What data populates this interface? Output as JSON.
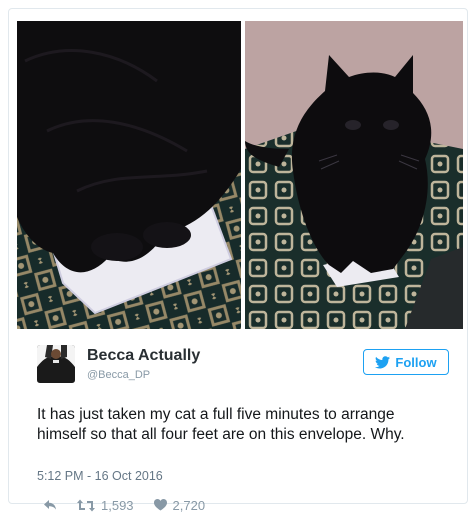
{
  "tweet": {
    "author_name": "Becca Actually",
    "author_handle": "@Becca_DP",
    "follow_label": "Follow",
    "text": "It has just taken my cat a full five minutes to arrange himself so that all four feet are on this envelope. Why.",
    "timestamp": "5:12 PM - 16 Oct 2016",
    "retweet_count": "1,593",
    "like_count": "2,720"
  },
  "icons": {
    "reply": "reply-icon",
    "retweet": "retweet-icon",
    "like": "heart-icon",
    "follow": "twitter-bird-icon"
  },
  "colors": {
    "accent": "#1da1f2",
    "text": "#14171a",
    "muted": "#8899a6"
  }
}
